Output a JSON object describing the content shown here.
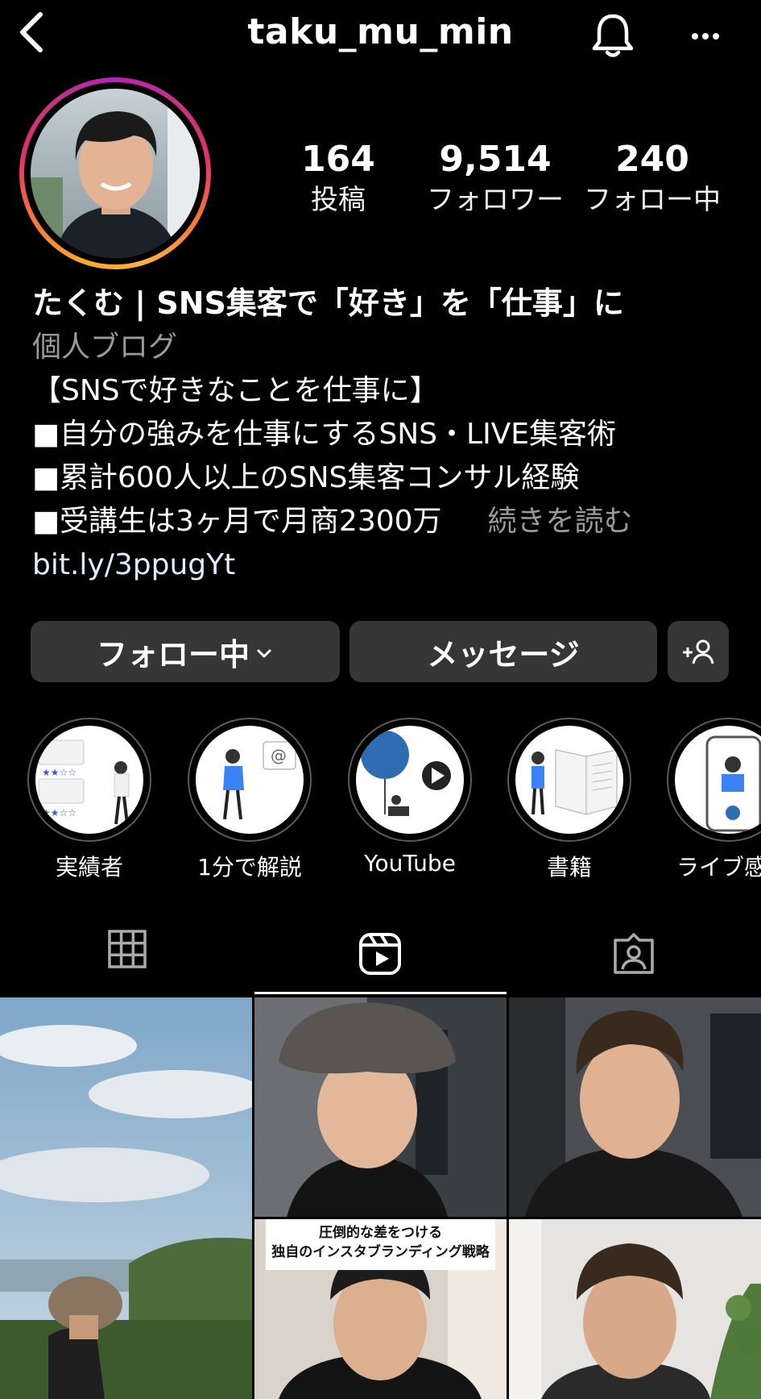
{
  "header": {
    "username": "taku_mu_min",
    "back_icon": "chevron-left-icon",
    "bell_icon": "bell-icon",
    "more_icon": "more-horizontal-icon"
  },
  "stats": [
    {
      "value": "164",
      "label": "投稿"
    },
    {
      "value": "9,514",
      "label": "フォロワー"
    },
    {
      "value": "240",
      "label": "フォロー中"
    }
  ],
  "bio": {
    "name": "たくむ | SNS集客で「好き」を「仕事」に",
    "category": "個人ブログ",
    "lines": [
      "【SNSで好きなことを仕事に】",
      "■自分の強みを仕事にするSNS・LIVE集客術",
      "■累計600人以上のSNS集客コンサル経験",
      "■受講生は3ヶ月で月商2300万"
    ],
    "read_more": "続きを読む",
    "link": "bit.ly/3ppugYt"
  },
  "buttons": {
    "following": "フォロー中",
    "message": "メッセージ",
    "add_user_icon": "add-user-icon"
  },
  "highlights": [
    {
      "label": "実績者"
    },
    {
      "label": "1分で解説"
    },
    {
      "label": "YouTube"
    },
    {
      "label": "書籍"
    },
    {
      "label": "ライブ感"
    }
  ],
  "tabs": [
    {
      "icon": "grid-icon"
    },
    {
      "icon": "reels-icon",
      "active": true
    },
    {
      "icon": "tagged-icon"
    }
  ],
  "grid_posts": [
    {
      "type": "landscape-photo"
    },
    {
      "type": "video"
    },
    {
      "type": "video"
    },
    {
      "type": "video",
      "caption_line1": "圧倒的な差をつける",
      "caption_line2": "独自のインスタブランディング戦略"
    },
    {
      "type": "video"
    }
  ],
  "colors": {
    "background": "#000000",
    "button_bg": "#363636",
    "muted_text": "#9a9a9a",
    "link_text": "#e0ecff"
  }
}
